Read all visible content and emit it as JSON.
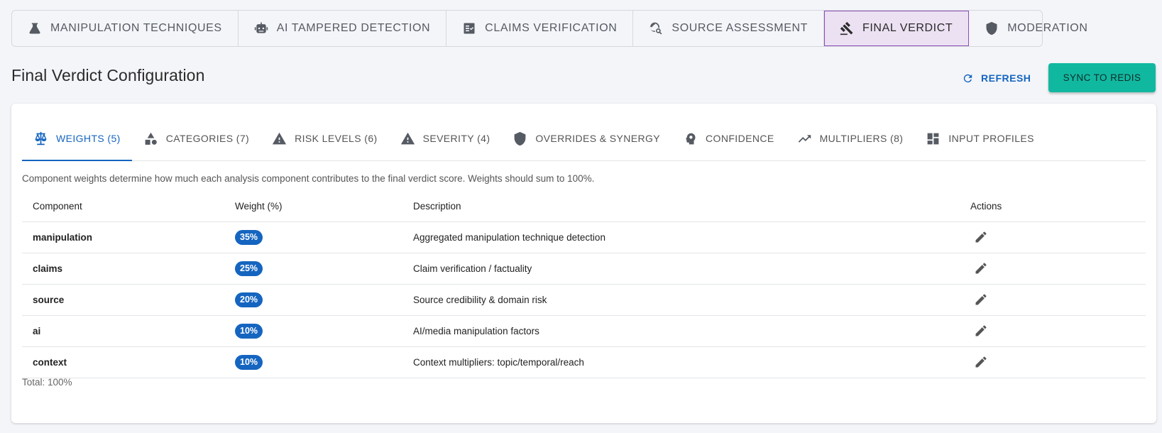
{
  "top_tabs": [
    {
      "label": "MANIPULATION TECHNIQUES",
      "icon": "flask-icon"
    },
    {
      "label": "AI TAMPERED DETECTION",
      "icon": "robot-icon"
    },
    {
      "label": "CLAIMS VERIFICATION",
      "icon": "checklist-icon"
    },
    {
      "label": "SOURCE ASSESSMENT",
      "icon": "globe-search-icon"
    },
    {
      "label": "FINAL VERDICT",
      "icon": "gavel-icon",
      "active": true
    },
    {
      "label": "MODERATION",
      "icon": "shield-icon"
    }
  ],
  "page": {
    "title": "Final Verdict Configuration",
    "refresh_label": "REFRESH",
    "sync_label": "SYNC TO REDIS"
  },
  "sub_tabs": [
    {
      "label": "WEIGHTS (5)",
      "icon": "scale-icon",
      "active": true
    },
    {
      "label": "CATEGORIES (7)",
      "icon": "shapes-icon"
    },
    {
      "label": "RISK LEVELS (6)",
      "icon": "warning-icon"
    },
    {
      "label": "SEVERITY (4)",
      "icon": "warning-icon"
    },
    {
      "label": "OVERRIDES & SYNERGY",
      "icon": "shield-icon"
    },
    {
      "label": "CONFIDENCE",
      "icon": "psychology-icon"
    },
    {
      "label": "MULTIPLIERS (8)",
      "icon": "trending-up-icon"
    },
    {
      "label": "INPUT PROFILES",
      "icon": "dashboard-icon"
    }
  ],
  "weights": {
    "intro": "Component weights determine how much each analysis component contributes to the final verdict score. Weights should sum to 100%.",
    "columns": {
      "component": "Component",
      "weight": "Weight (%)",
      "description": "Description",
      "actions": "Actions"
    },
    "rows": [
      {
        "component": "manipulation",
        "weight": "35%",
        "description": "Aggregated manipulation technique detection"
      },
      {
        "component": "claims",
        "weight": "25%",
        "description": "Claim verification / factuality"
      },
      {
        "component": "source",
        "weight": "20%",
        "description": "Source credibility & domain risk"
      },
      {
        "component": "ai",
        "weight": "10%",
        "description": "AI/media manipulation factors"
      },
      {
        "component": "context",
        "weight": "10%",
        "description": "Context multipliers: topic/temporal/reach"
      }
    ],
    "total": "Total: 100%"
  },
  "colors": {
    "accent": "#1565c0",
    "sync_button": "#11b8a0",
    "active_tab_bg": "#ece1f2",
    "active_tab_border": "#8a4fb5"
  }
}
